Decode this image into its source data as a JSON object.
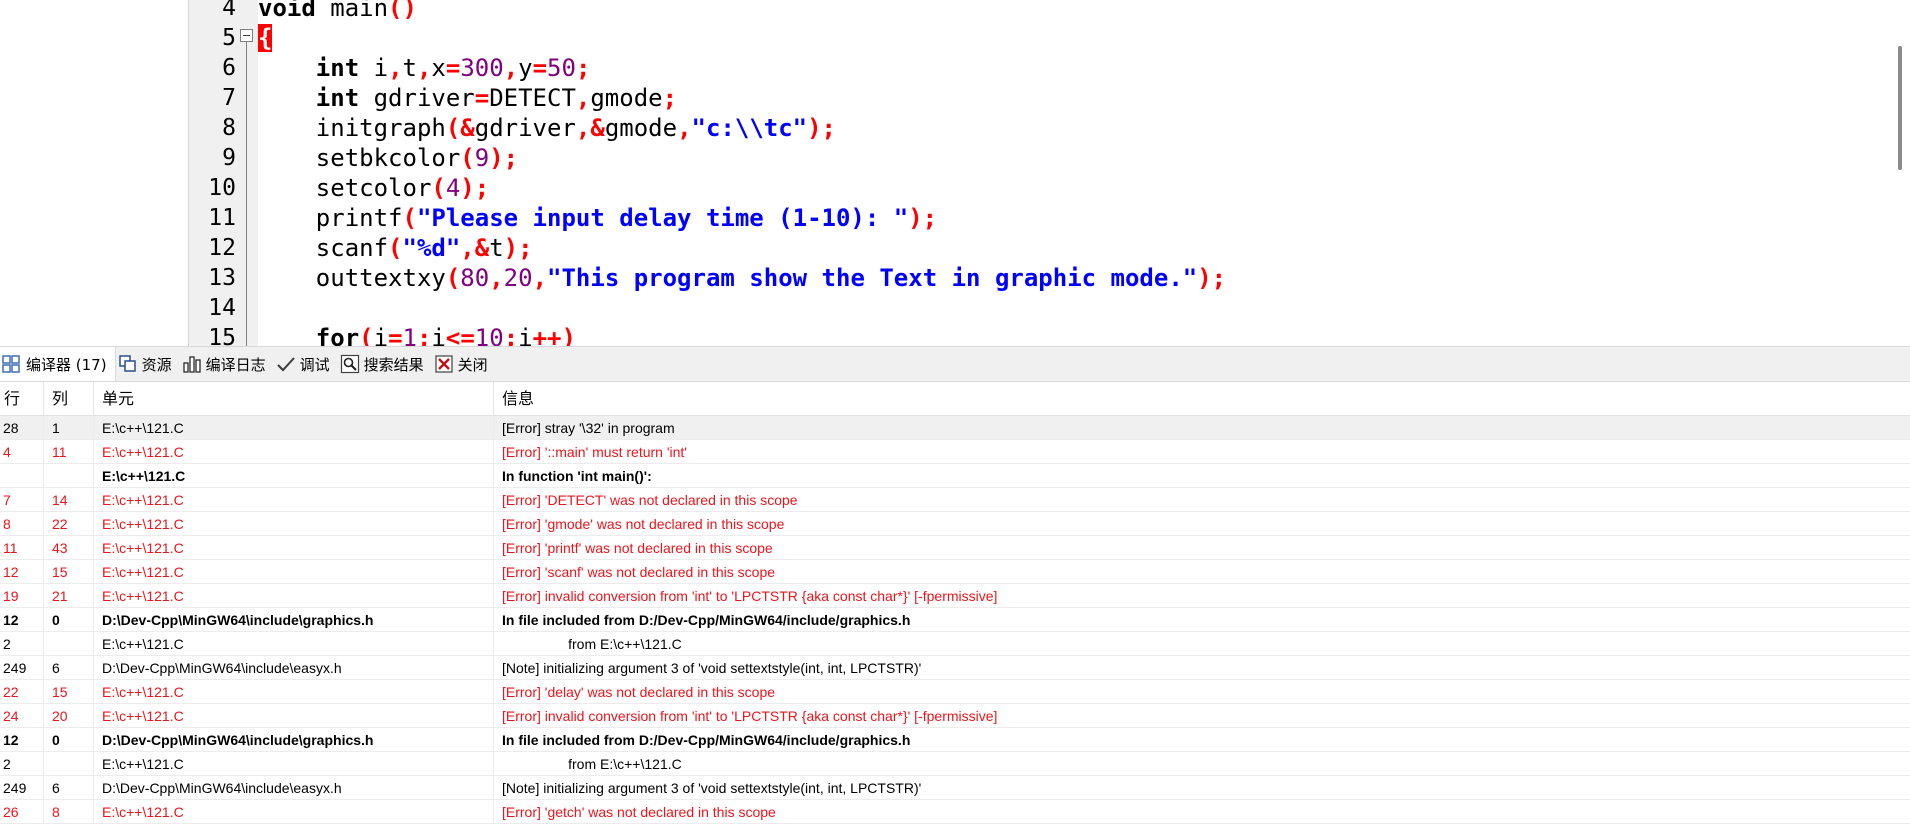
{
  "editor": {
    "fold_symbol": "minus",
    "lines": [
      {
        "no": "4"
      },
      {
        "no": "5"
      },
      {
        "no": "6"
      },
      {
        "no": "7"
      },
      {
        "no": "8"
      },
      {
        "no": "9"
      },
      {
        "no": "10"
      },
      {
        "no": "11"
      },
      {
        "no": "12"
      },
      {
        "no": "13"
      },
      {
        "no": "14"
      },
      {
        "no": "15"
      }
    ],
    "code": {
      "l4_kw": "void",
      "l4_id": " main",
      "l4_paren": "()",
      "l5_brace": "{",
      "l6_kw": "int",
      "l6_a": " i",
      "l6_c1": ",",
      "l6_b": "t",
      "l6_c2": ",",
      "l6_c": "x",
      "l6_eq1": "=",
      "l6_n1": "300",
      "l6_c3": ",",
      "l6_d": "y",
      "l6_eq2": "=",
      "l6_n2": "50",
      "l6_sc": ";",
      "l7_kw": "int",
      "l7_a": " gdriver",
      "l7_eq": "=",
      "l7_b": "DETECT",
      "l7_c1": ",",
      "l7_c": "gmode",
      "l7_sc": ";",
      "l8_a": "initgraph",
      "l8_p1": "(&",
      "l8_b": "gdriver",
      "l8_c1": ",&",
      "l8_c": "gmode",
      "l8_c2": ",",
      "l8_s": "\"c:\\\\tc\"",
      "l8_end": ");",
      "l9_a": "setbkcolor",
      "l9_p1": "(",
      "l9_n": "9",
      "l9_end": ");",
      "l10_a": "setcolor",
      "l10_p1": "(",
      "l10_n": "4",
      "l10_end": ");",
      "l11_a": "printf",
      "l11_p1": "(",
      "l11_s": "\"Please input delay time (1-10): \"",
      "l11_end": ");",
      "l12_a": "scanf",
      "l12_p1": "(",
      "l12_s": "\"%d\"",
      "l12_c1": ",&",
      "l12_b": "t",
      "l12_end": ");",
      "l13_a": "outtextxy",
      "l13_p1": "(",
      "l13_n1": "80",
      "l13_c1": ",",
      "l13_n2": "20",
      "l13_c2": ",",
      "l13_s": "\"This program show the Text in graphic mode.\"",
      "l13_end": ");",
      "l15_a": "for",
      "l15_p1": "(",
      "l15_b": "i",
      "l15_eq": "=",
      "l15_n1": "1",
      "l15_sc1": ";",
      "l15_c": "i",
      "l15_le": "<=",
      "l15_n2": "10",
      "l15_sc2": ";",
      "l15_d": "i",
      "l15_pp": "++",
      "l15_end": ")"
    }
  },
  "tabs": [
    {
      "label": "编译器 (17)",
      "icon": "compiler-grid-icon"
    },
    {
      "label": "资源",
      "icon": "resources-icon"
    },
    {
      "label": "编译日志",
      "icon": "bar-chart-icon"
    },
    {
      "label": "调试",
      "icon": "check-icon"
    },
    {
      "label": "搜索结果",
      "icon": "search-icon"
    },
    {
      "label": "关闭",
      "icon": "close-icon"
    }
  ],
  "messages": {
    "headers": {
      "line": "行",
      "col": "列",
      "unit": "单元",
      "msg": "信息"
    },
    "rows": [
      {
        "line": "28",
        "col": "1",
        "unit": "E:\\c++\\121.C",
        "msg": "[Error] stray '\\32' in program",
        "kind": "normal",
        "selected": true
      },
      {
        "line": "4",
        "col": "11",
        "unit": "E:\\c++\\121.C",
        "msg": "[Error] '::main' must return 'int'",
        "kind": "error"
      },
      {
        "line": "",
        "col": "",
        "unit": "E:\\c++\\121.C",
        "msg": "In function 'int main()':",
        "kind": "bold"
      },
      {
        "line": "7",
        "col": "14",
        "unit": "E:\\c++\\121.C",
        "msg": "[Error] 'DETECT' was not declared in this scope",
        "kind": "error"
      },
      {
        "line": "8",
        "col": "22",
        "unit": "E:\\c++\\121.C",
        "msg": "[Error] 'gmode' was not declared in this scope",
        "kind": "error"
      },
      {
        "line": "11",
        "col": "43",
        "unit": "E:\\c++\\121.C",
        "msg": "[Error] 'printf' was not declared in this scope",
        "kind": "error"
      },
      {
        "line": "12",
        "col": "15",
        "unit": "E:\\c++\\121.C",
        "msg": "[Error] 'scanf' was not declared in this scope",
        "kind": "error"
      },
      {
        "line": "19",
        "col": "21",
        "unit": "E:\\c++\\121.C",
        "msg": "[Error] invalid conversion from 'int' to 'LPCTSTR {aka const char*}' [-fpermissive]",
        "kind": "error"
      },
      {
        "line": "12",
        "col": "0",
        "unit": "D:\\Dev-Cpp\\MinGW64\\include\\graphics.h",
        "msg": "In file included from D:/Dev-Cpp/MinGW64/include/graphics.h",
        "kind": "bold"
      },
      {
        "line": "2",
        "col": "",
        "unit": "E:\\c++\\121.C",
        "msg": "                 from E:\\c++\\121.C",
        "kind": "normal"
      },
      {
        "line": "249",
        "col": "6",
        "unit": "D:\\Dev-Cpp\\MinGW64\\include\\easyx.h",
        "msg": "[Note] initializing argument 3 of 'void settextstyle(int, int, LPCTSTR)'",
        "kind": "normal"
      },
      {
        "line": "22",
        "col": "15",
        "unit": "E:\\c++\\121.C",
        "msg": "[Error] 'delay' was not declared in this scope",
        "kind": "error"
      },
      {
        "line": "24",
        "col": "20",
        "unit": "E:\\c++\\121.C",
        "msg": "[Error] invalid conversion from 'int' to 'LPCTSTR {aka const char*}' [-fpermissive]",
        "kind": "error"
      },
      {
        "line": "12",
        "col": "0",
        "unit": "D:\\Dev-Cpp\\MinGW64\\include\\graphics.h",
        "msg": "In file included from D:/Dev-Cpp/MinGW64/include/graphics.h",
        "kind": "bold"
      },
      {
        "line": "2",
        "col": "",
        "unit": "E:\\c++\\121.C",
        "msg": "                 from E:\\c++\\121.C",
        "kind": "normal"
      },
      {
        "line": "249",
        "col": "6",
        "unit": "D:\\Dev-Cpp\\MinGW64\\include\\easyx.h",
        "msg": "[Note] initializing argument 3 of 'void settextstyle(int, int, LPCTSTR)'",
        "kind": "normal"
      },
      {
        "line": "26",
        "col": "8",
        "unit": "E:\\c++\\121.C",
        "msg": "[Error] 'getch' was not declared in this scope",
        "kind": "error"
      }
    ]
  },
  "colors": {
    "error": "#e8161c",
    "keyword": "#000000",
    "operator": "#ff0000",
    "number": "#800080",
    "string": "#0000ff",
    "brace_highlight": "#ff0000",
    "selected_row": "#f0f0f0"
  }
}
